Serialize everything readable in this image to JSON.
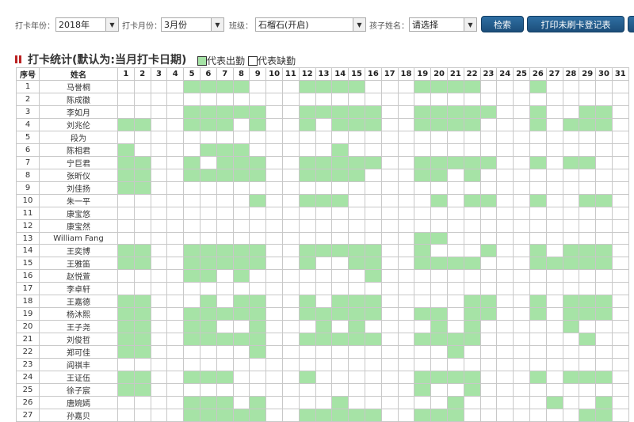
{
  "filters": {
    "year_label": "打卡年份：",
    "year_value": "2018年",
    "month_label": "打卡月份：",
    "month_value": "3月份",
    "class_label": "班级：",
    "class_value": "石榴石(开启)",
    "child_label": "孩子姓名：",
    "child_value": "请选择",
    "search_button": "检索",
    "print_button": "打印未刷卡登记表"
  },
  "section": {
    "title": "打卡统计(默认为:当月打卡日期)",
    "legend_present": "代表出勤",
    "legend_absent": "代表缺勤"
  },
  "colors": {
    "present": "#a6e3a6",
    "absent": "#ffffff",
    "button": "#1c4e7a"
  },
  "table": {
    "col_seq": "序号",
    "col_name": "姓名",
    "days": [
      "1",
      "2",
      "3",
      "4",
      "5",
      "6",
      "7",
      "8",
      "9",
      "10",
      "11",
      "12",
      "13",
      "14",
      "15",
      "16",
      "17",
      "18",
      "19",
      "20",
      "21",
      "22",
      "23",
      "24",
      "25",
      "26",
      "27",
      "28",
      "29",
      "30",
      "31"
    ],
    "rows": [
      {
        "seq": "1",
        "name": "马誉桐",
        "present": [
          5,
          6,
          7,
          8,
          12,
          13,
          14,
          15,
          19,
          20,
          21,
          22,
          26
        ]
      },
      {
        "seq": "2",
        "name": "陈成徽",
        "present": []
      },
      {
        "seq": "3",
        "name": "李如月",
        "present": [
          5,
          6,
          7,
          8,
          9,
          12,
          13,
          14,
          15,
          16,
          19,
          20,
          21,
          22,
          23,
          26,
          29,
          30
        ]
      },
      {
        "seq": "4",
        "name": "刘兆伦",
        "present": [
          1,
          2,
          5,
          6,
          7,
          9,
          12,
          14,
          15,
          16,
          19,
          20,
          21,
          22,
          26,
          28,
          29,
          30
        ]
      },
      {
        "seq": "5",
        "name": "段为",
        "present": []
      },
      {
        "seq": "6",
        "name": "陈相君",
        "present": [
          1,
          6,
          7,
          8,
          14
        ]
      },
      {
        "seq": "7",
        "name": "宁巨君",
        "present": [
          1,
          2,
          5,
          7,
          8,
          9,
          12,
          13,
          14,
          15,
          16,
          19,
          20,
          21,
          22,
          23,
          26,
          28,
          29
        ]
      },
      {
        "seq": "8",
        "name": "张昕仪",
        "present": [
          1,
          2,
          5,
          6,
          7,
          8,
          9,
          12,
          13,
          14,
          15,
          19,
          20,
          22
        ]
      },
      {
        "seq": "9",
        "name": "刘佳扬",
        "present": [
          1,
          2
        ]
      },
      {
        "seq": "10",
        "name": "朱一平",
        "present": [
          9,
          12,
          13,
          14,
          20,
          22,
          23,
          26,
          29,
          30
        ]
      },
      {
        "seq": "11",
        "name": "康宝悠",
        "present": []
      },
      {
        "seq": "12",
        "name": "康宝然",
        "present": []
      },
      {
        "seq": "13",
        "name": "William Fang",
        "present": [
          19,
          20
        ]
      },
      {
        "seq": "14",
        "name": "王奕博",
        "present": [
          1,
          2,
          5,
          6,
          7,
          8,
          9,
          12,
          13,
          14,
          15,
          16,
          19,
          23,
          26,
          28,
          29,
          30
        ]
      },
      {
        "seq": "15",
        "name": "王雅笛",
        "present": [
          1,
          2,
          5,
          6,
          7,
          8,
          9,
          12,
          15,
          16,
          19,
          20,
          21,
          22,
          26,
          27,
          28,
          29,
          30
        ]
      },
      {
        "seq": "16",
        "name": "赵悦萱",
        "present": [
          5,
          6,
          8,
          16
        ]
      },
      {
        "seq": "17",
        "name": "李卓轩",
        "present": []
      },
      {
        "seq": "18",
        "name": "王嘉德",
        "present": [
          1,
          2,
          6,
          8,
          9,
          12,
          14,
          15,
          16,
          22,
          23,
          26,
          28,
          29,
          30
        ]
      },
      {
        "seq": "19",
        "name": "杨沐熙",
        "present": [
          1,
          2,
          5,
          6,
          7,
          8,
          9,
          12,
          13,
          14,
          15,
          16,
          19,
          20,
          22,
          23,
          26,
          28,
          29,
          30
        ]
      },
      {
        "seq": "20",
        "name": "王子尧",
        "present": [
          1,
          2,
          5,
          6,
          9,
          13,
          15,
          20,
          22,
          28
        ]
      },
      {
        "seq": "21",
        "name": "刘俊哲",
        "present": [
          1,
          2,
          5,
          6,
          7,
          8,
          9,
          12,
          13,
          14,
          15,
          16,
          19,
          20,
          21,
          22,
          29
        ]
      },
      {
        "seq": "22",
        "name": "郑可佳",
        "present": [
          1,
          2,
          9,
          21
        ]
      },
      {
        "seq": "23",
        "name": "阎祺丰",
        "present": []
      },
      {
        "seq": "24",
        "name": "王证伍",
        "present": [
          1,
          2,
          5,
          6,
          7,
          12,
          19,
          20,
          21,
          22,
          26,
          28,
          29,
          30
        ]
      },
      {
        "seq": "25",
        "name": "徐子宸",
        "present": [
          1,
          2,
          19,
          22
        ]
      },
      {
        "seq": "26",
        "name": "唐婉嫣",
        "present": [
          5,
          6,
          7,
          9,
          14,
          21,
          27,
          30
        ]
      },
      {
        "seq": "27",
        "name": "孙嘉贝",
        "present": [
          5,
          6,
          7,
          8,
          9,
          12,
          13,
          14,
          15,
          16,
          19,
          20,
          21,
          29,
          30
        ]
      }
    ]
  }
}
